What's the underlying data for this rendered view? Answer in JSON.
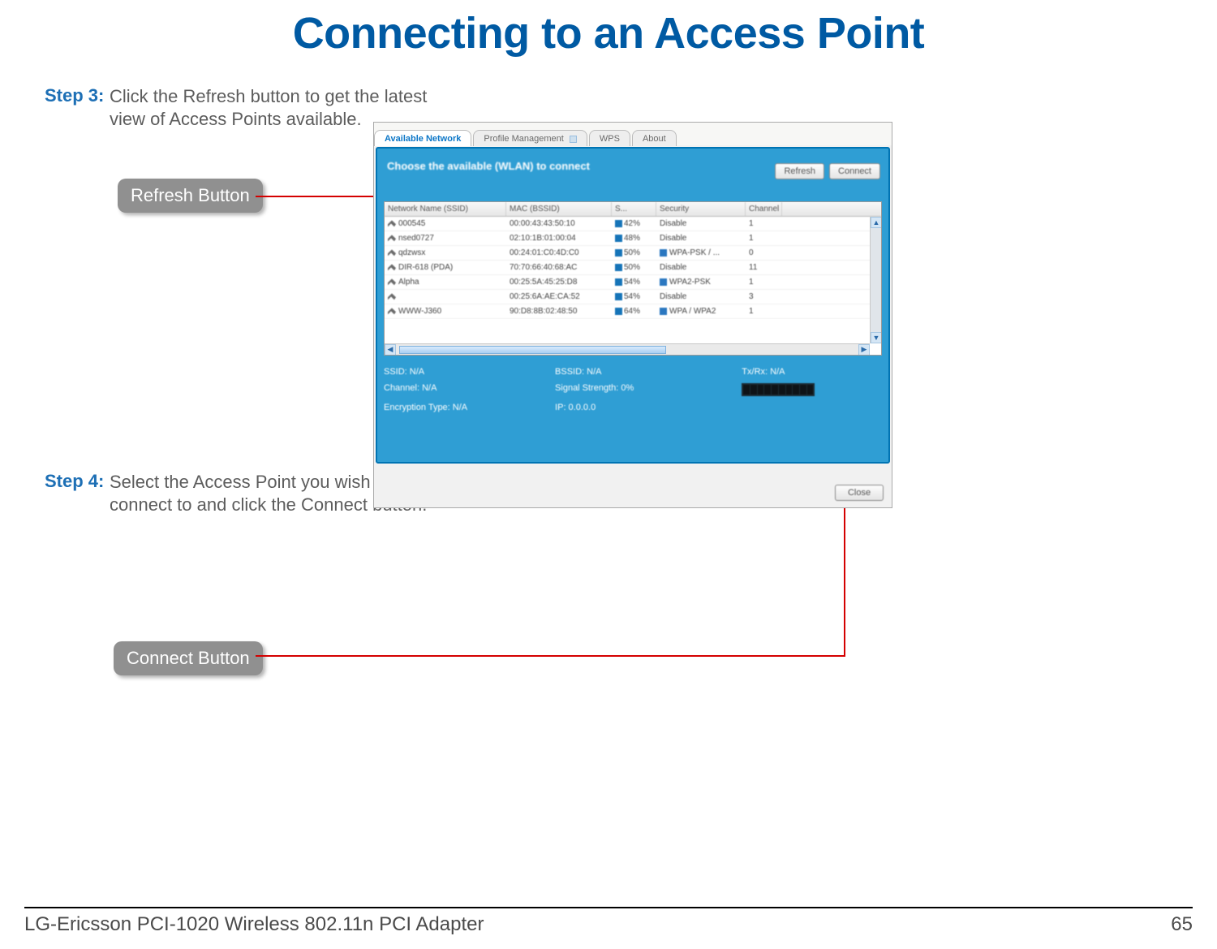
{
  "title": "Connecting to an Access Point",
  "steps": {
    "s3": {
      "label": "Step 3:",
      "text": "Click the Refresh button to get the latest view of Access Points available."
    },
    "s4": {
      "label": "Step 4:",
      "text": "Select the Access Point you wish to connect to and click the Connect button."
    }
  },
  "callouts": {
    "refresh": "Refresh Button",
    "connect": "Connect Button"
  },
  "tabs": {
    "available": "Available Network",
    "profile": "Profile Management",
    "wps": "WPS",
    "about": "About"
  },
  "panel": {
    "prompt": "Choose the available (WLAN) to connect",
    "refresh_btn": "Refresh",
    "connect_btn": "Connect",
    "close_btn": "Close"
  },
  "columns": {
    "ssid": "Network Name (SSID)",
    "mac": "MAC (BSSID)",
    "signal": "S...",
    "security": "Security",
    "channel": "Channel"
  },
  "networks": [
    {
      "ssid": "000545",
      "mac": "00:00:43:43:50:10",
      "signal": "42%",
      "sec": "Disable",
      "sec_icon": false,
      "ch": "1"
    },
    {
      "ssid": "nsed0727",
      "mac": "02:10:1B:01:00:04",
      "signal": "48%",
      "sec": "Disable",
      "sec_icon": false,
      "ch": "1"
    },
    {
      "ssid": "qdzwsx",
      "mac": "00:24:01:C0:4D:C0",
      "signal": "50%",
      "sec": "WPA-PSK / ...",
      "sec_icon": true,
      "ch": "0"
    },
    {
      "ssid": "DIR-618 (PDA)",
      "mac": "70:70:66:40:68:AC",
      "signal": "50%",
      "sec": "Disable",
      "sec_icon": false,
      "ch": "11"
    },
    {
      "ssid": "Alpha",
      "mac": "00:25:5A:45:25:D8",
      "signal": "54%",
      "sec": "WPA2-PSK",
      "sec_icon": true,
      "ch": "1"
    },
    {
      "ssid": "",
      "mac": "00:25:6A:AE:CA:52",
      "signal": "54%",
      "sec": "Disable",
      "sec_icon": false,
      "ch": "3"
    },
    {
      "ssid": "WWW-J360",
      "mac": "90:D8:8B:02:48:50",
      "signal": "64%",
      "sec": "WPA / WPA2",
      "sec_icon": true,
      "ch": "1"
    }
  ],
  "status": {
    "ssid": "SSID: N/A",
    "bssid": "BSSID: N/A",
    "txrx": "Tx/Rx: N/A",
    "channel": "Channel: N/A",
    "strength": "Signal Strength: 0%",
    "enc": "Encryption Type: N/A",
    "ip": "IP: 0.0.0.0"
  },
  "footer": {
    "product": "LG-Ericsson PCI-1020 Wireless 802.11n PCI Adapter",
    "page": "65"
  }
}
